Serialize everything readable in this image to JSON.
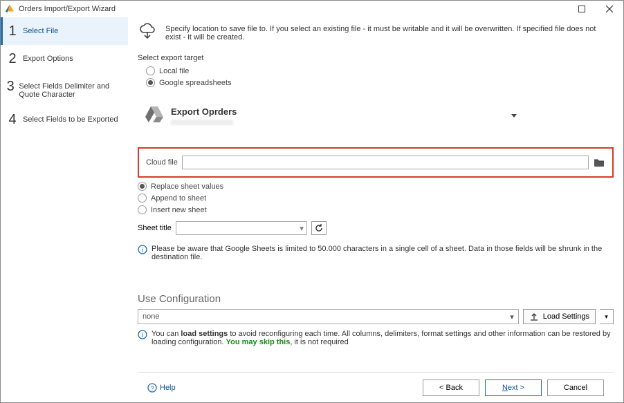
{
  "window": {
    "title": "Orders Import/Export Wizard"
  },
  "sidebar": {
    "steps": [
      {
        "num": "1",
        "label": "Select File"
      },
      {
        "num": "2",
        "label": "Export Options"
      },
      {
        "num": "3",
        "label": "Select Fields Delimiter and Quote Character"
      },
      {
        "num": "4",
        "label": "Select Fields to be Exported"
      }
    ]
  },
  "hint": "Specify location to save file to. If you select an existing file - it must be writable and it will be overwritten. If specified file does not exist - it will be created.",
  "exportTarget": {
    "label": "Select export target",
    "options": [
      "Local file",
      "Google spreadsheets"
    ]
  },
  "drive": {
    "title": "Export Oprders"
  },
  "cloud": {
    "label": "Cloud file",
    "value": ""
  },
  "sheetMode": {
    "options": [
      "Replace sheet values",
      "Append to sheet",
      "Insert new sheet"
    ]
  },
  "sheetTitle": {
    "label": "Sheet title"
  },
  "warn1": "Please be aware that Google Sheets is limited to 50.000 characters in a single cell of a sheet. Data in those fields will be shrunk in the destination file.",
  "config": {
    "heading": "Use Configuration",
    "value": "none",
    "loadLabel": "Load Settings",
    "info_prefix": "You can ",
    "info_bold": "load settings",
    "info_mid": " to avoid reconfiguring each time. All columns, delimiters, format settings and other information can be restored by loading configuration. ",
    "info_green": "You may skip this",
    "info_suffix": ", it is not required"
  },
  "footer": {
    "help": "Help",
    "back": "< Back",
    "next": "Next >",
    "cancel": "Cancel"
  }
}
